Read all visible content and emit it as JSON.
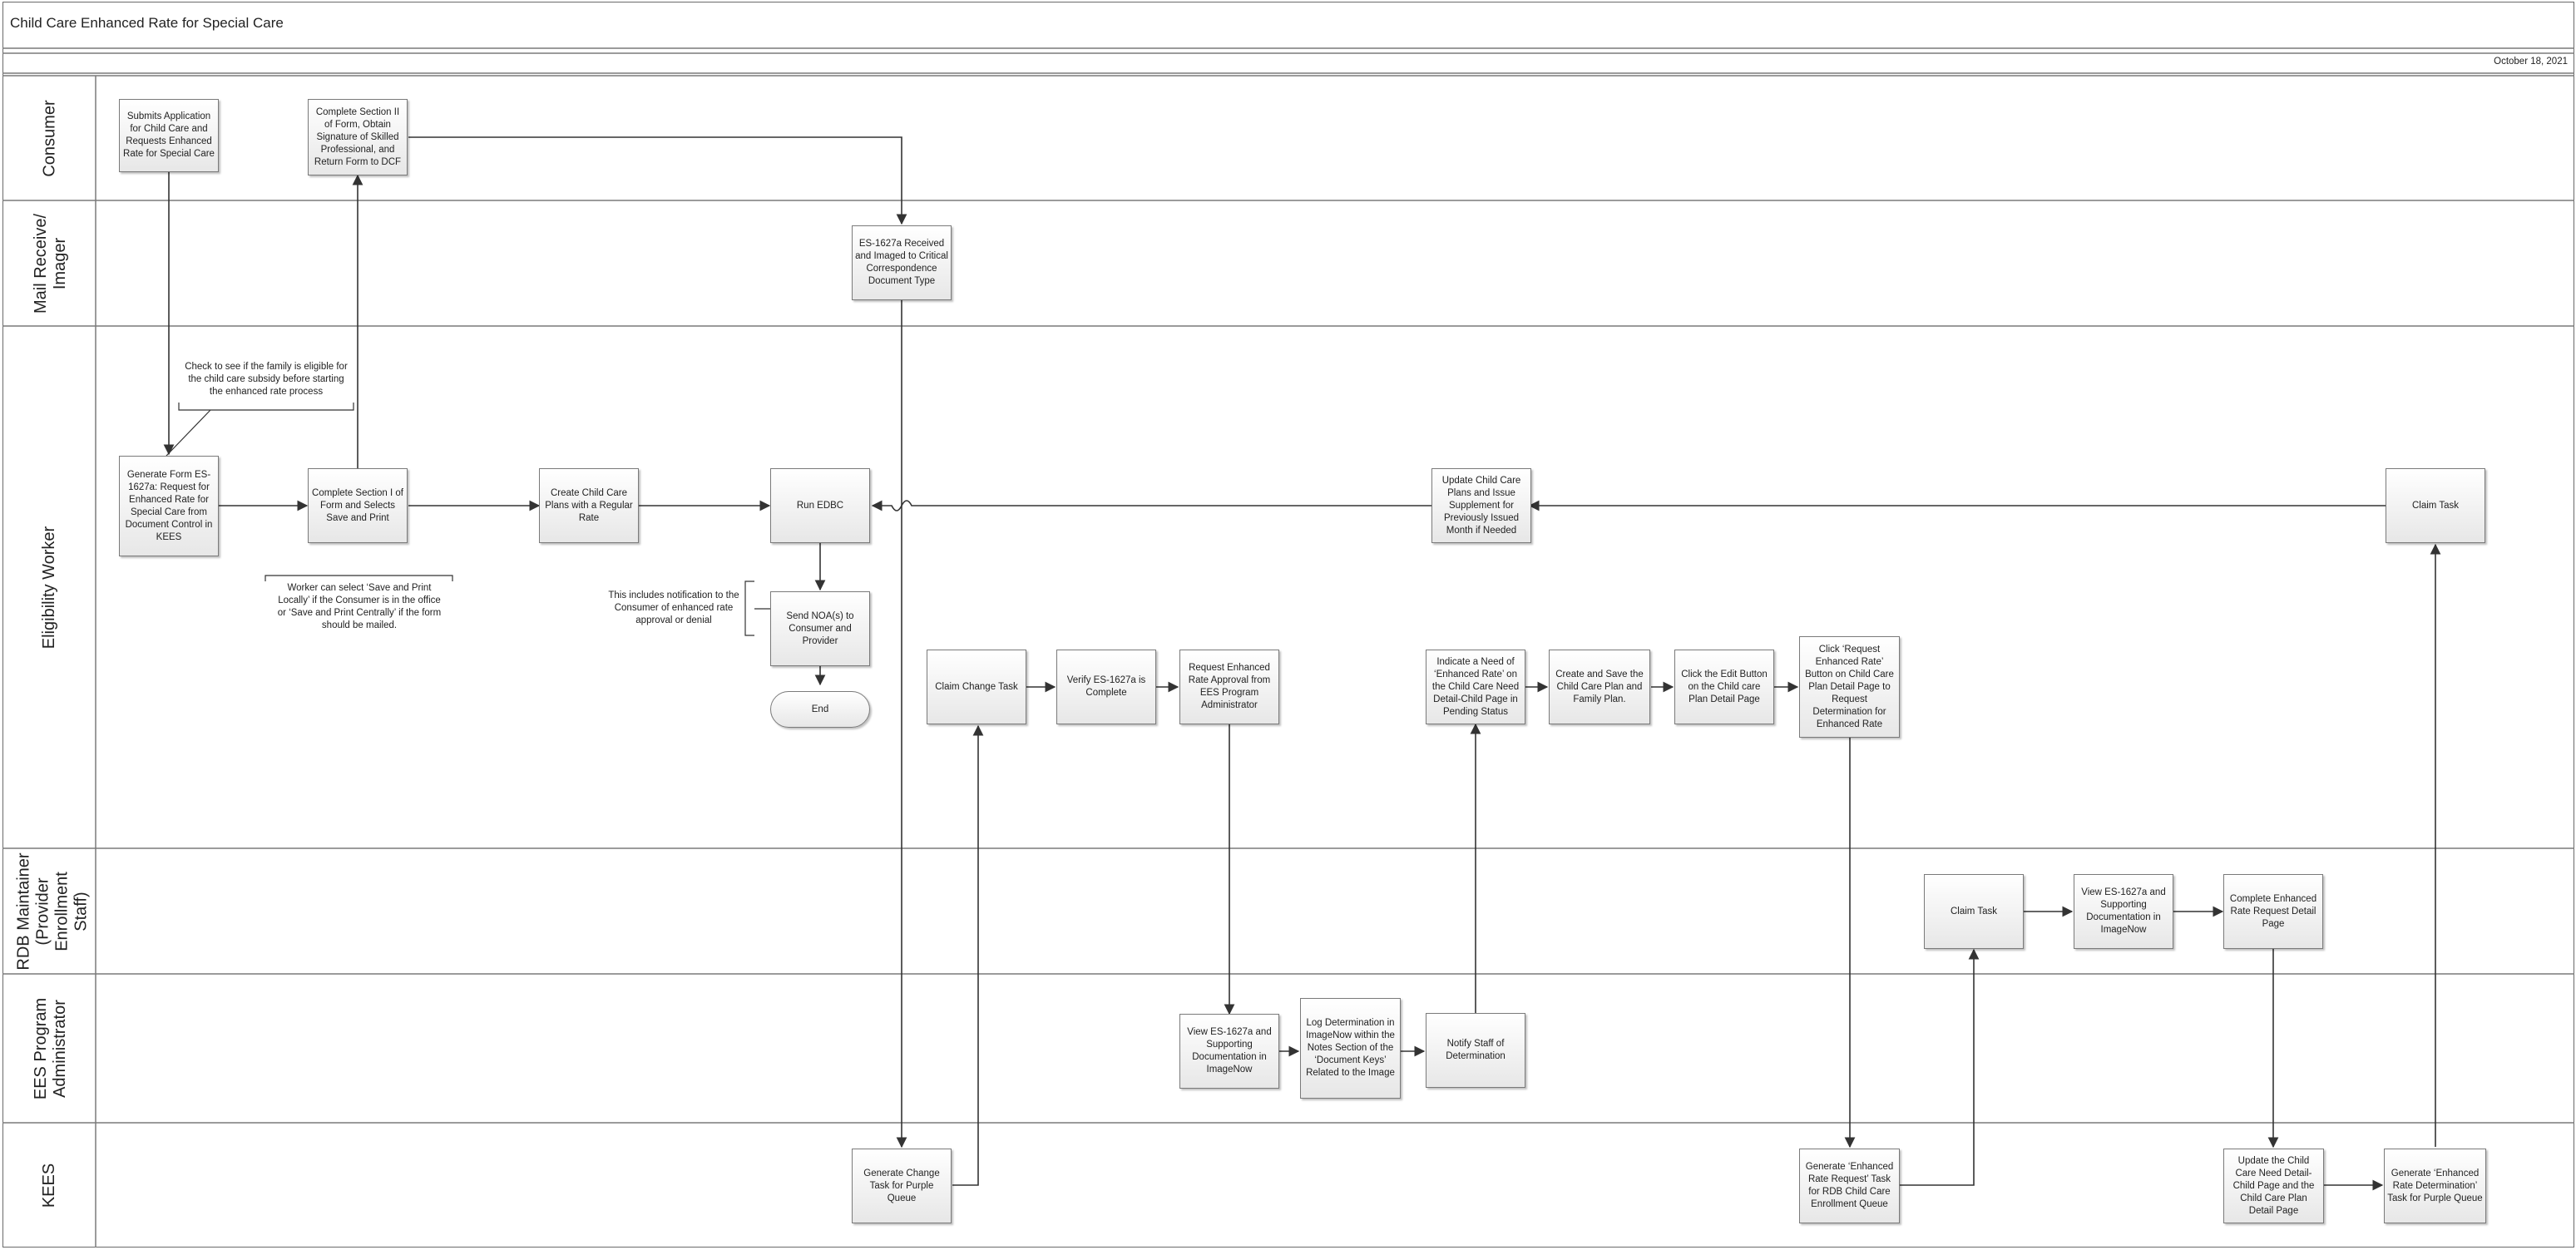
{
  "title": "Child Care Enhanced Rate for Special Care",
  "date": "October 18, 2021",
  "lanes": {
    "consumer": "Consumer",
    "mail": "Mail Receive/\nImager",
    "eligibility": "Eligibility Worker",
    "rdb": "RDB Maintainer\n(Provider\nEnrollment\nStaff)",
    "ees": "EES Program\nAdministrator",
    "kees": "KEES"
  },
  "steps": {
    "submit_app": "Submits Application for Child Care and Requests Enhanced Rate for Special Care",
    "complete_section_ii": "Complete Section II of Form, Obtain Signature of Skilled Professional, and Return Form to DCF",
    "received_imaged": "ES-1627a Received and Imaged to Critical Correspondence Document Type",
    "generate_form": "Generate Form ES-1627a:  Request for Enhanced Rate for Special Care from Document Control in KEES",
    "complete_section_i": "Complete Section I of Form and Selects Save and Print",
    "create_plans": "Create Child Care Plans with a Regular Rate",
    "run_edbc": "Run EDBC",
    "send_noa": "Send NOA(s) to Consumer and Provider",
    "end": "End",
    "update_plans": "Update Child Care Plans and Issue Supplement for Previously Issued Month if Needed",
    "claim_task_ew": "Claim Task",
    "claim_change_task": "Claim Change Task",
    "verify_complete": "Verify ES-1627a is Complete",
    "request_approval": "Request Enhanced Rate Approval from EES Program Administrator",
    "indicate_need": "Indicate a Need of ‘Enhanced Rate’ on the Child Care Need Detail-Child Page in Pending Status",
    "create_save": "Create and Save the Child Care Plan and Family Plan.",
    "click_edit": "Click the Edit Button on the Child care Plan Detail Page",
    "click_request": "Click ‘Request Enhanced Rate’ Button on Child Care Plan Detail Page to Request Determination for Enhanced Rate",
    "claim_task_rdb": "Claim Task",
    "view_rdb": "View ES-1627a and Supporting Documentation in ImageNow",
    "complete_request_detail": "Complete Enhanced Rate Request Detail Page",
    "view_ees": "View ES-1627a and Supporting Documentation in ImageNow",
    "log_determination": "Log Determination in ImageNow within the Notes Section of the ‘Document Keys’ Related to the Image",
    "notify_staff": "Notify Staff of Determination",
    "generate_change_task": "Generate Change Task for Purple Queue",
    "generate_rdb_task": "Generate ‘Enhanced Rate Request’ Task for RDB Child Care Enrollment Queue",
    "update_need_detail": "Update the Child Care Need Detail-Child Page and the Child Care Plan Detail Page",
    "generate_determination_task": "Generate ‘Enhanced Rate Determination’ Task for Purple Queue"
  },
  "notes": {
    "eligible_check": "Check to see if the family is eligible for the child care subsidy before starting the enhanced rate process",
    "save_print": "Worker can select ‘Save and Print Locally’ if the Consumer is in the office or ‘Save and Print Centrally’ if the form should be mailed.",
    "noa_note": "This includes notification to the Consumer of enhanced rate approval or denial"
  }
}
